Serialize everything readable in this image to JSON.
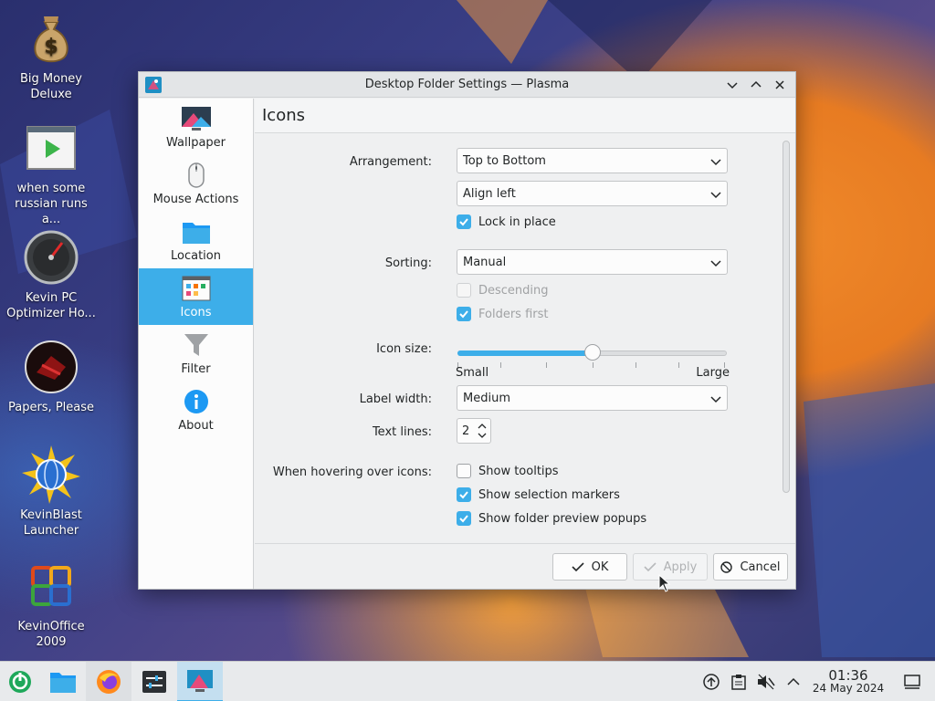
{
  "desktop": {
    "icons": [
      {
        "label": "Big Money Deluxe",
        "icon": "money-bag-icon"
      },
      {
        "label": "when some russian runs a...",
        "icon": "video-thumbnail-icon"
      },
      {
        "label": "Kevin PC Optimizer Ho...",
        "icon": "speedometer-icon"
      },
      {
        "label": "Papers, Please",
        "icon": "papers-please-icon"
      },
      {
        "label": "KevinBlast Launcher",
        "icon": "globe-burst-icon"
      },
      {
        "label": "KevinOffice 2009",
        "icon": "office-logo-icon"
      }
    ]
  },
  "window": {
    "title": "Desktop Folder Settings — Plasma",
    "sidebar": [
      {
        "label": "Wallpaper",
        "icon": "monitor-icon"
      },
      {
        "label": "Mouse Actions",
        "icon": "mouse-icon"
      },
      {
        "label": "Location",
        "icon": "folder-icon"
      },
      {
        "label": "Icons",
        "icon": "icons-grid-icon",
        "active": true
      },
      {
        "label": "Filter",
        "icon": "funnel-icon"
      },
      {
        "label": "About",
        "icon": "info-icon"
      }
    ],
    "page_title": "Icons",
    "form": {
      "arrangement_label": "Arrangement:",
      "arrangement_value": "Top to Bottom",
      "align_value": "Align left",
      "lock_label": "Lock in place",
      "lock_checked": true,
      "sorting_label": "Sorting:",
      "sorting_value": "Manual",
      "descending_label": "Descending",
      "descending_checked": false,
      "folders_first_label": "Folders first",
      "folders_first_checked": true,
      "icon_size_label": "Icon size:",
      "icon_size_fraction": 0.5,
      "icon_size_min": "Small",
      "icon_size_max": "Large",
      "label_width_label": "Label width:",
      "label_width_value": "Medium",
      "text_lines_label": "Text lines:",
      "text_lines_value": "2",
      "hover_label": "When hovering over icons:",
      "tooltips_label": "Show tooltips",
      "tooltips_checked": false,
      "selection_markers_label": "Show selection markers",
      "selection_markers_checked": true,
      "preview_popups_label": "Show folder preview popups",
      "preview_popups_checked": true
    },
    "buttons": {
      "ok": "OK",
      "apply": "Apply",
      "cancel": "Cancel"
    }
  },
  "taskbar": {
    "time": "01:36",
    "date": "24 May 2024"
  },
  "colors": {
    "accent": "#3daee9",
    "window_bg": "#eff0f1"
  }
}
